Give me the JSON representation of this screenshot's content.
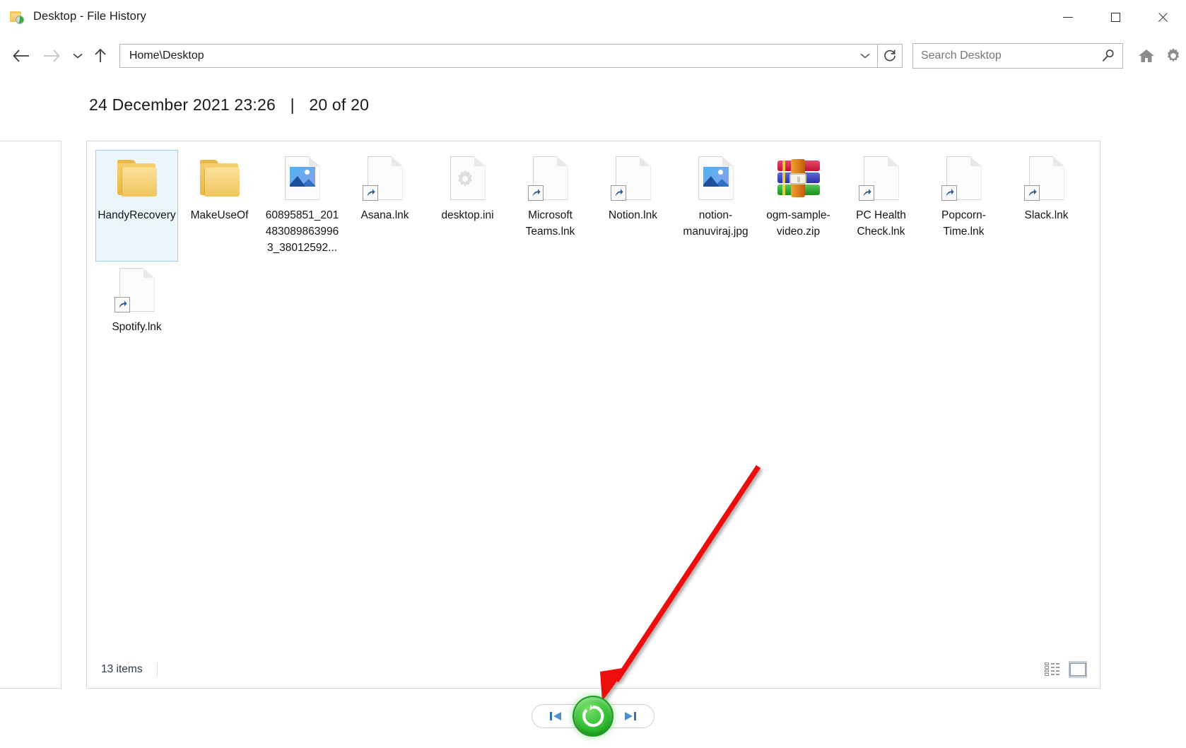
{
  "window": {
    "title": "Desktop - File History",
    "app_icon": "folder-history-icon",
    "minimize_label": "Minimize",
    "maximize_label": "Maximize",
    "close_label": "Close"
  },
  "navbar": {
    "back_label": "Back",
    "forward_label": "Forward",
    "recent_label": "Recent locations",
    "up_label": "Up",
    "address_value": "Home\\Desktop",
    "refresh_label": "Refresh",
    "search_placeholder": "Search Desktop",
    "search_value": "",
    "home_label": "Home",
    "settings_label": "Settings"
  },
  "version_header": {
    "timestamp": "24 December 2021 23:26",
    "separator": "|",
    "counter": "20 of 20"
  },
  "files": [
    {
      "name": "HandyRecovery",
      "type": "folder",
      "selected": true
    },
    {
      "name": "MakeUseOf",
      "type": "folder",
      "selected": false
    },
    {
      "name": "60895851_2014830898639963_38012592...",
      "type": "image",
      "selected": false
    },
    {
      "name": "Asana.lnk",
      "type": "shortcut",
      "selected": false
    },
    {
      "name": "desktop.ini",
      "type": "ini",
      "selected": false
    },
    {
      "name": "Microsoft Teams.lnk",
      "type": "shortcut",
      "selected": false
    },
    {
      "name": "Notion.lnk",
      "type": "shortcut",
      "selected": false
    },
    {
      "name": "notion-manuviraj.jpg",
      "type": "image",
      "selected": false
    },
    {
      "name": "ogm-sample-video.zip",
      "type": "zip",
      "selected": false
    },
    {
      "name": "PC Health Check.lnk",
      "type": "shortcut",
      "selected": false
    },
    {
      "name": "Popcorn-Time.lnk",
      "type": "shortcut",
      "selected": false
    },
    {
      "name": "Slack.lnk",
      "type": "shortcut",
      "selected": false
    },
    {
      "name": "Spotify.lnk",
      "type": "shortcut",
      "selected": false
    }
  ],
  "statusbar": {
    "item_count": "13 items",
    "view_details_label": "Details view",
    "view_large_icons_label": "Large icons view"
  },
  "version_nav": {
    "previous_label": "Previous version",
    "restore_label": "Restore to original location",
    "next_label": "Next version"
  },
  "colors": {
    "accent_selection": "#9ed0ef",
    "selection_fill": "#eaf5fc",
    "restore_green": "#14a21a",
    "annotation_red": "#ee1111",
    "folder_yellow": "#f0c65d"
  },
  "annotation": {
    "type": "arrow",
    "target": "restore-button"
  }
}
